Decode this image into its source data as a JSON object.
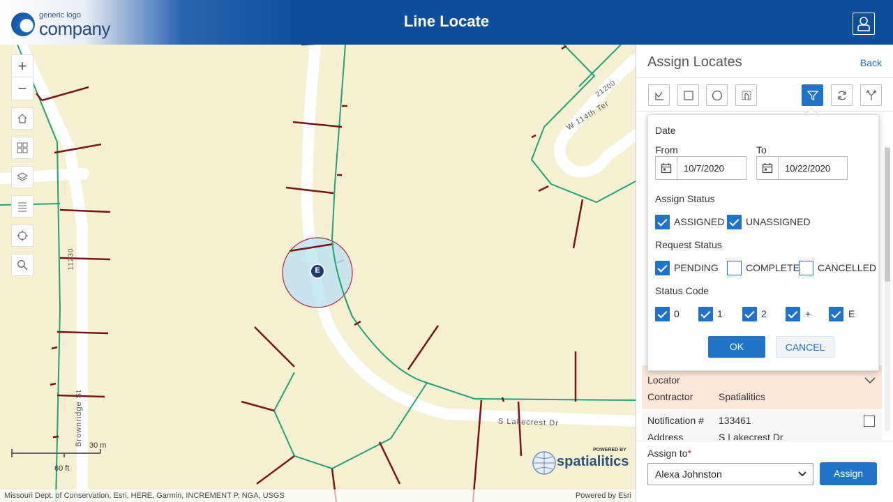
{
  "header": {
    "logo_small": "generic logo",
    "logo_big": "company",
    "title": "Line Locate"
  },
  "map": {
    "streets": {
      "lakecrest": "S Lakecrest Dr",
      "ter": "W 114th Ter",
      "brownridge": "Brownridge St",
      "addr_21200": "21200",
      "addr_11230": "11230"
    },
    "marker_label": "E",
    "scale": {
      "top": "30 m",
      "bottom": "60 ft"
    },
    "attribution_left": "Missouri Dept. of Conservation, Esri, HERE, Garmin, INCREMENT P, NGA, USGS",
    "attribution_right": "Powered by Esri",
    "powered_by": {
      "small": "POWERED BY",
      "brand": "spatialitics"
    }
  },
  "panel": {
    "title": "Assign Locates",
    "back": "Back",
    "card": {
      "locator_label": "Locator",
      "contractor_label": "Contractor",
      "contractor_value": "Spatialitics"
    },
    "notification": {
      "label": "Notification #",
      "value": "133461",
      "address_label": "Address",
      "address_value": "S Lakecrest Dr"
    },
    "assign": {
      "label": "Assign to",
      "required": "*",
      "selected": "Alexa Johnston",
      "button": "Assign"
    }
  },
  "filter": {
    "date_heading": "Date",
    "from_label": "From",
    "to_label": "To",
    "from_value": "10/7/2020",
    "to_value": "10/22/2020",
    "assign_status_heading": "Assign Status",
    "assign_status": [
      {
        "label": "ASSIGNED",
        "checked": true
      },
      {
        "label": "UNASSIGNED",
        "checked": true
      }
    ],
    "request_status_heading": "Request Status",
    "request_status": [
      {
        "label": "PENDING",
        "checked": true
      },
      {
        "label": "COMPLETE",
        "checked": false
      },
      {
        "label": "CANCELLED",
        "checked": false
      }
    ],
    "status_code_heading": "Status Code",
    "status_codes": [
      {
        "label": "0",
        "checked": true
      },
      {
        "label": "1",
        "checked": true
      },
      {
        "label": "2",
        "checked": true
      },
      {
        "label": "+",
        "checked": true
      },
      {
        "label": "E",
        "checked": true
      }
    ],
    "ok": "OK",
    "cancel": "CANCEL"
  },
  "colors": {
    "accent": "#1f73c9",
    "header": "#0d4f9c",
    "map_bg": "#f6f0d2",
    "main_line": "#1fa274",
    "service_line": "#7a1414"
  }
}
